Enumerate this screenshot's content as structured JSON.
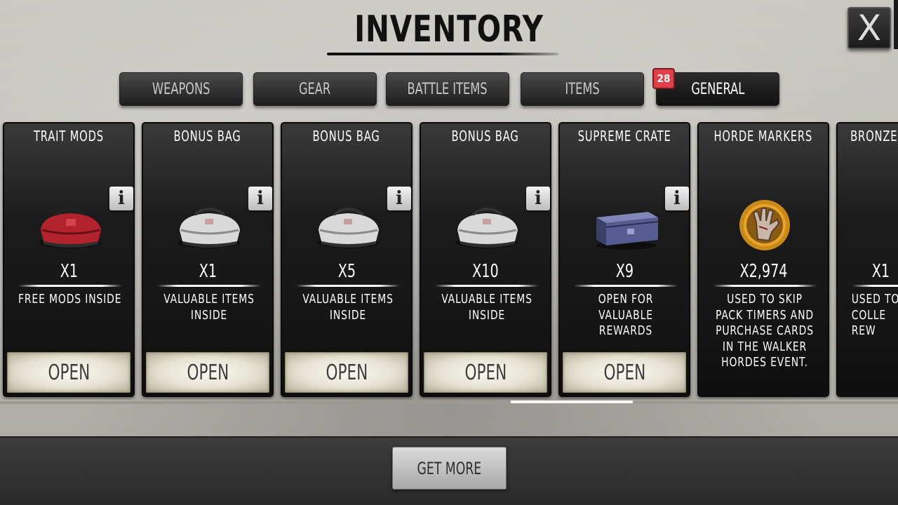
{
  "screen": {
    "title": "INVENTORY"
  },
  "close_button": {
    "label": "X"
  },
  "tabs": [
    {
      "label": "WEAPONS",
      "active": false
    },
    {
      "label": "GEAR",
      "active": false
    },
    {
      "label": "BATTLE ITEMS",
      "active": false
    },
    {
      "label": "ITEMS",
      "active": false
    },
    {
      "label": "GENERAL",
      "active": true,
      "badge": "28"
    }
  ],
  "cards": [
    {
      "title": "TRAIT MODS",
      "quantity": "X1",
      "description": "FREE MODS INSIDE",
      "action": "OPEN",
      "has_info": true,
      "icon": "red-duffel-bag-icon"
    },
    {
      "title": "BONUS BAG",
      "quantity": "X1",
      "description": "VALUABLE ITEMS INSIDE",
      "action": "OPEN",
      "has_info": true,
      "icon": "white-duffel-bag-icon"
    },
    {
      "title": "BONUS BAG",
      "quantity": "X5",
      "description": "VALUABLE ITEMS INSIDE",
      "action": "OPEN",
      "has_info": true,
      "icon": "white-duffel-bag-icon"
    },
    {
      "title": "BONUS BAG",
      "quantity": "X10",
      "description": "VALUABLE ITEMS INSIDE",
      "action": "OPEN",
      "has_info": true,
      "icon": "white-duffel-bag-icon"
    },
    {
      "title": "SUPREME CRATE",
      "quantity": "X9",
      "description": "OPEN FOR VALUABLE REWARDS",
      "action": "OPEN",
      "has_info": true,
      "icon": "blue-crate-icon"
    },
    {
      "title": "HORDE MARKERS",
      "quantity": "X2,974",
      "description": "USED TO SKIP PACK TIMERS AND PURCHASE CARDS IN THE WALKER HORDES EVENT.",
      "action": "",
      "has_info": false,
      "icon": "zombie-hand-medal-icon"
    },
    {
      "title": "BRONZE TI",
      "quantity": "X1",
      "description": "USED TO COLLE REW",
      "action": "",
      "has_info": false,
      "icon": "bronze-star-medal-icon"
    }
  ],
  "footer": {
    "get_more_label": "GET MORE"
  },
  "colors": {
    "badge": "#e0404a",
    "card_bg": "#1b1b1b",
    "open_button": "#e5e2d2"
  }
}
